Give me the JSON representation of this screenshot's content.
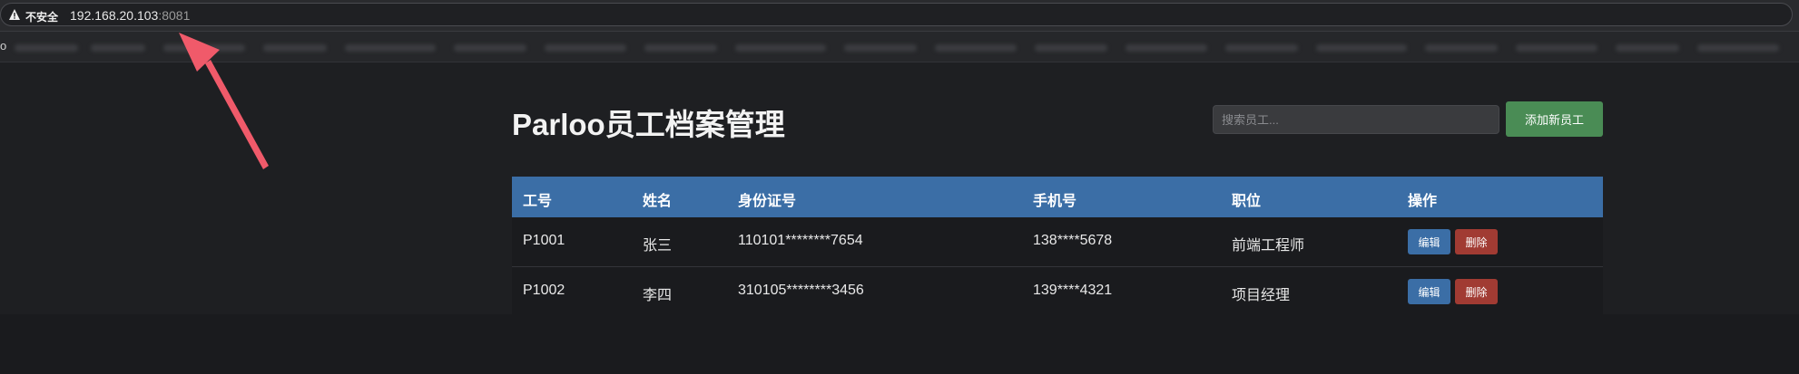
{
  "browser": {
    "insecure_label": "不安全",
    "url_host": "192.168.20.103",
    "url_port": ":8081",
    "bookmark_stub": "o"
  },
  "page": {
    "title": "Parloo员工档案管理",
    "search_placeholder": "搜索员工...",
    "add_button": "添加新员工"
  },
  "table": {
    "headers": [
      "工号",
      "姓名",
      "身份证号",
      "手机号",
      "职位",
      "操作"
    ],
    "rows": [
      {
        "id": "P1001",
        "name": "张三",
        "id_card": "110101********7654",
        "phone": "138****5678",
        "position": "前端工程师",
        "edit": "编辑",
        "delete": "删除"
      },
      {
        "id": "P1002",
        "name": "李四",
        "id_card": "310105********3456",
        "phone": "139****4321",
        "position": "项目经理",
        "edit": "编辑",
        "delete": "删除"
      }
    ]
  },
  "colors": {
    "header_bg": "#3b6ea6",
    "add_button_bg": "#4a8c55",
    "delete_button_bg": "#a13b33",
    "annotation_arrow": "#f05a6a"
  },
  "icons": [
    "warning-icon"
  ]
}
